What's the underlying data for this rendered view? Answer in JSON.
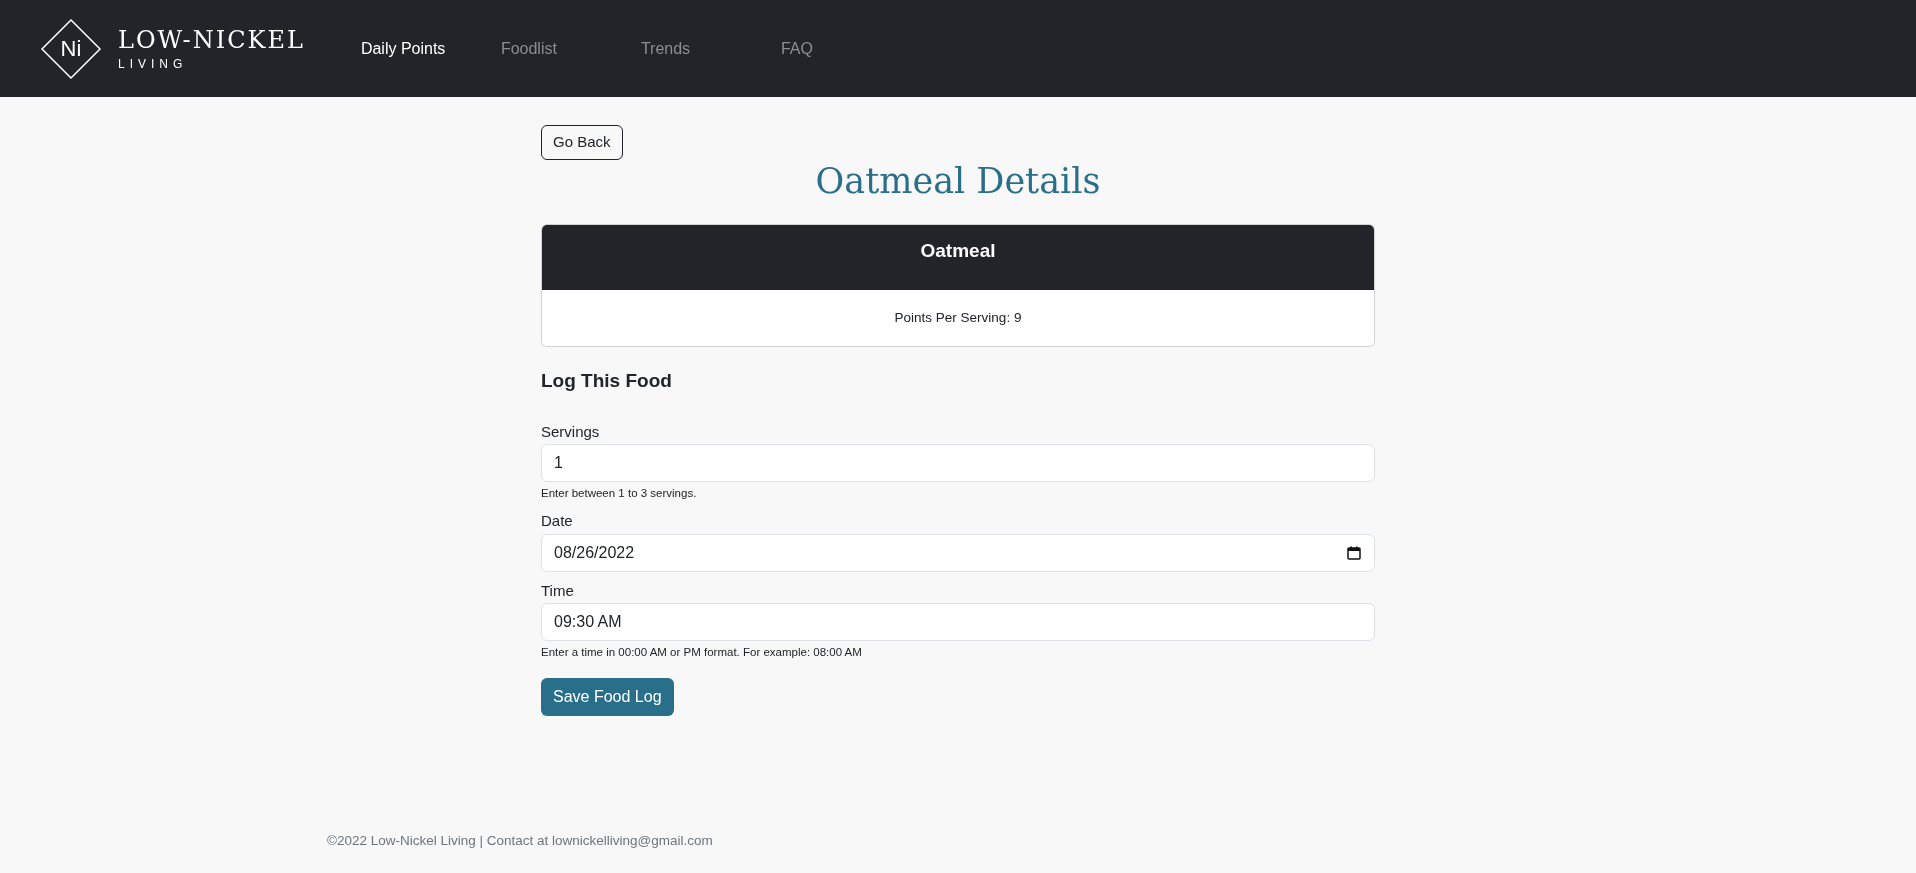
{
  "brand": {
    "mark": "Ni",
    "name": "LOW-NICKEL",
    "tagline": "LIVING"
  },
  "nav": [
    {
      "label": "Daily Points",
      "selected": true
    },
    {
      "label": "Foodlist",
      "selected": false
    },
    {
      "label": "Trends",
      "selected": false
    },
    {
      "label": "FAQ",
      "selected": false
    }
  ],
  "back_button": "Go Back",
  "title": "Oatmeal Details",
  "food_card": {
    "name": "Oatmeal",
    "points": "Points Per Serving: 9"
  },
  "form": {
    "heading": "Log This Food",
    "fields": [
      {
        "kind": "number",
        "label": "Servings",
        "value": "1",
        "help": "Enter between 1 to 3 servings."
      },
      {
        "kind": "date",
        "label": "Date",
        "value": "08/26/2022"
      },
      {
        "kind": "time",
        "label": "Time",
        "value": "09:30 AM",
        "help": "Enter a time in 00:00 AM or PM format. For example: 08:00 AM"
      }
    ],
    "submit": "Save Food Log"
  },
  "footer": "©2022 Low-Nickel Living | Contact at lownickelliving@gmail.com"
}
